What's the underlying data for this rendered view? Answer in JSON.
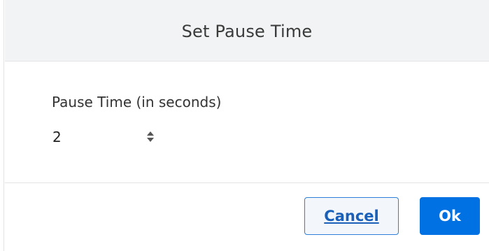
{
  "dialog": {
    "title": "Set Pause Time",
    "field_label": "Pause Time (in seconds)",
    "pause_time_value": "2",
    "cancel_label": "Cancel",
    "ok_label": "Ok"
  },
  "colors": {
    "header_bg": "#f1f3f4",
    "primary": "#0071e3",
    "cancel_border": "#2f7fd8"
  },
  "icons": {
    "spinner": "up-down-spinner-icon"
  }
}
